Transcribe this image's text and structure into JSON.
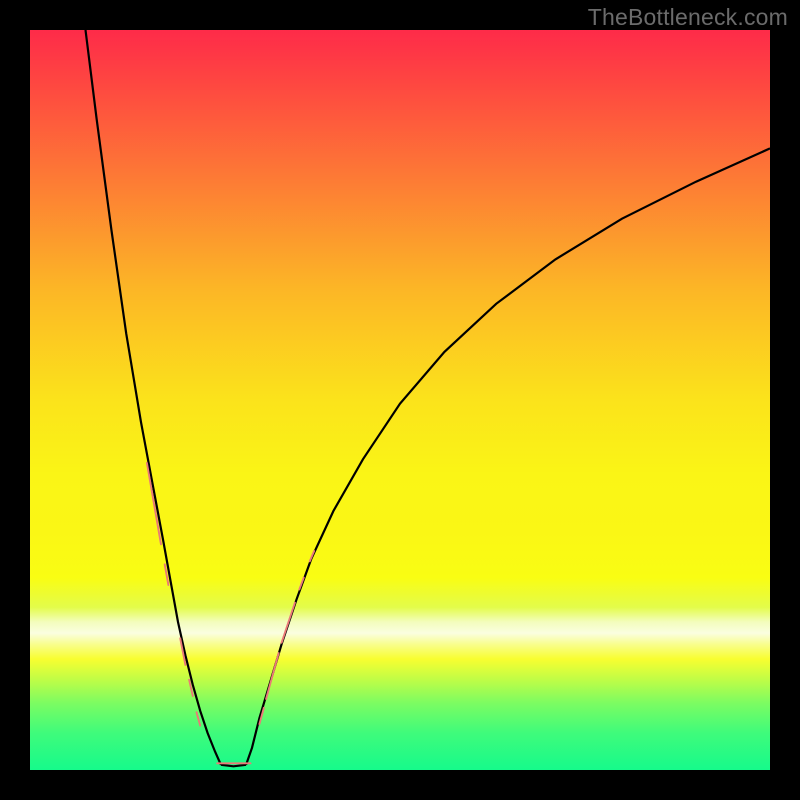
{
  "watermark": "TheBottleneck.com",
  "colors": {
    "curve": "#000000",
    "marker": "#ea7a77",
    "bg_top": "#fe2b49",
    "bg_bottom": "#16fa8b"
  },
  "chart_data": {
    "type": "line",
    "title": "",
    "xlabel": "",
    "ylabel": "",
    "xlim": [
      0,
      100
    ],
    "ylim": [
      0,
      100
    ],
    "note": "Axes unlabeled; values estimated from pixel positions on a 0–100 normalized grid where (0,0) is bottom-left of the gradient area.",
    "series": [
      {
        "name": "left-curve",
        "x": [
          7.5,
          9,
          11,
          13,
          15,
          16.5,
          18,
          19,
          20,
          21,
          22,
          23,
          24,
          25,
          25.8
        ],
        "y": [
          100,
          88,
          73,
          59,
          47,
          39,
          31,
          25.5,
          20,
          15.5,
          11.5,
          8,
          5,
          2.5,
          0.7
        ]
      },
      {
        "name": "right-curve",
        "x": [
          29.2,
          30,
          31,
          32.5,
          34,
          36,
          38,
          41,
          45,
          50,
          56,
          63,
          71,
          80,
          90,
          100
        ],
        "y": [
          0.7,
          3,
          7,
          12,
          17,
          23,
          28.5,
          35,
          42,
          49.5,
          56.5,
          63,
          69,
          74.5,
          79.5,
          84
        ]
      },
      {
        "name": "valley-floor",
        "x": [
          25.8,
          27.5,
          29.2
        ],
        "y": [
          0.7,
          0.5,
          0.7
        ]
      }
    ],
    "markers": {
      "name": "pink-dot-clusters",
      "style": "rounded-capsule",
      "color": "#ea7a77",
      "points_note": "Approximate capsule segments [x1,y1,x2,y2] in same 0–100 space",
      "segments": [
        [
          15.8,
          41.5,
          17.7,
          30.5
        ],
        [
          18.2,
          27.8,
          18.7,
          25.0
        ],
        [
          20.3,
          17.8,
          21.0,
          14.2
        ],
        [
          21.5,
          12.2,
          22.0,
          10.0
        ],
        [
          22.5,
          7.8,
          23.0,
          6.0
        ],
        [
          25.3,
          0.9,
          29.8,
          0.9
        ],
        [
          31.0,
          6.2,
          31.6,
          8.4
        ],
        [
          31.9,
          9.6,
          33.6,
          15.8
        ],
        [
          34.0,
          17.2,
          35.8,
          22.6
        ],
        [
          36.4,
          24.4,
          37.0,
          26.0
        ],
        [
          37.8,
          28.2,
          38.4,
          29.6
        ]
      ]
    }
  }
}
